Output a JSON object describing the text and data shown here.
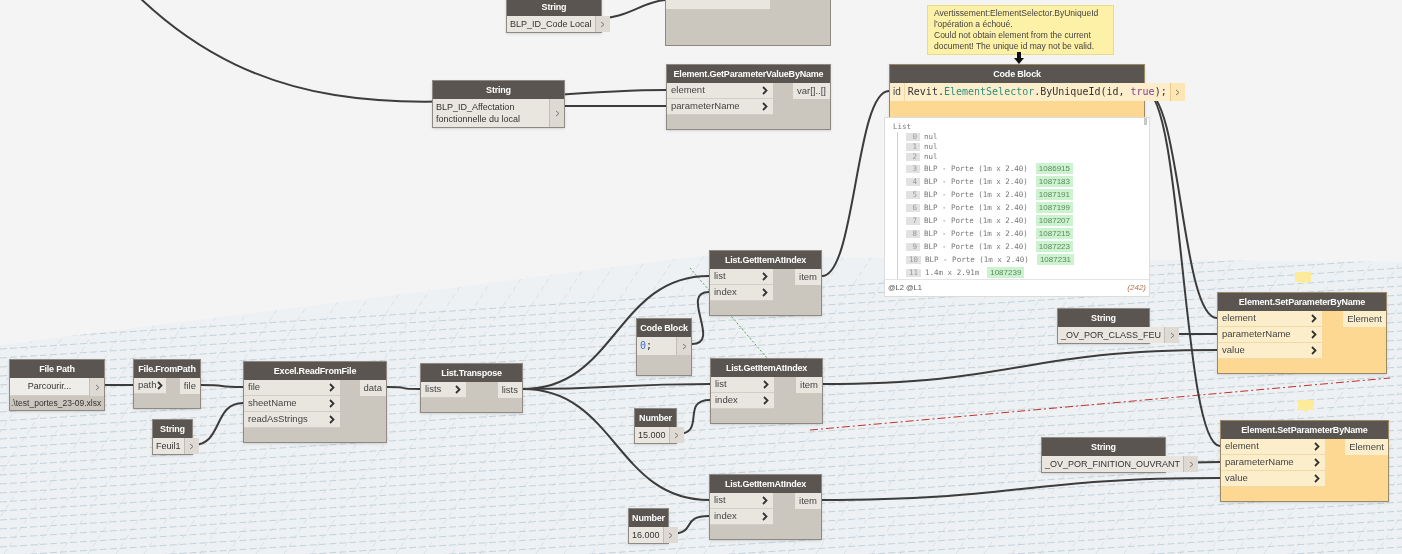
{
  "nodes": [
    {
      "kind": "input",
      "title": "String",
      "value": "BLP_ID_Code Local",
      "warning": false
    },
    {
      "kind": "input",
      "title": "String",
      "value": "BLP_ID_Affectation fonctionnelle du local",
      "warning": false
    },
    {
      "kind": "function",
      "title": "Element.GetParameterValueByName",
      "inputs": [
        "element",
        "parameterName"
      ],
      "outputs": [
        "var[]..[]"
      ],
      "warning": false
    },
    {
      "kind": "function",
      "title": "List.GetItemAtIndex",
      "inputs": [
        "list",
        "index"
      ],
      "outputs": [
        "item"
      ],
      "warning": false
    },
    {
      "kind": "code_block",
      "title": "Code Block",
      "input": "id",
      "code": [
        {
          "kind": "plain",
          "text": "Revit."
        },
        {
          "kind": "class",
          "text": "ElementSelector"
        },
        {
          "kind": "plain",
          "text": ".ByUniqueId(id, "
        },
        {
          "kind": "keyword",
          "text": "true"
        },
        {
          "kind": "plain",
          "text": ");"
        }
      ],
      "warning": true,
      "tooltip": [
        "Avertissement:ElementSelector.ByUniqueId",
        "l'opération a échoué.",
        "Could not obtain element from the current",
        "document!  The unique id may not be valid."
      ],
      "preview": {
        "root": "List",
        "items": [
          {
            "index": "0",
            "text": "nul"
          },
          {
            "index": "1",
            "text": "nul"
          },
          {
            "index": "2",
            "text": "nul"
          },
          {
            "index": "3",
            "text": "BLP - Porte (1m x 2.40)",
            "id": "1086915"
          },
          {
            "index": "4",
            "text": "BLP - Porte (1m x 2.40)",
            "id": "1087183"
          },
          {
            "index": "5",
            "text": "BLP - Porte (1m x 2.40)",
            "id": "1087191"
          },
          {
            "index": "6",
            "text": "BLP - Porte (1m x 2.40)",
            "id": "1087199"
          },
          {
            "index": "7",
            "text": "BLP - Porte (1m x 2.40)",
            "id": "1087207"
          },
          {
            "index": "8",
            "text": "BLP - Porte (1m x 2.40)",
            "id": "1087215"
          },
          {
            "index": "9",
            "text": "BLP - Porte (1m x 2.40)",
            "id": "1087223"
          },
          {
            "index": "10",
            "text": "BLP - Porte (1m x 2.40)",
            "id": "1087231"
          },
          {
            "index": "11",
            "text": "1.4m x 2.91m",
            "id": "1087239"
          }
        ],
        "levels": [
          "@L2",
          "@L1"
        ],
        "count": "(242)"
      }
    },
    {
      "kind": "code_block",
      "title": "Code Block",
      "code": [
        {
          "kind": "number",
          "text": "0"
        },
        {
          "kind": "plain",
          "text": ";"
        }
      ],
      "warning": false
    },
    {
      "kind": "function",
      "title": "List.GetItemAtIndex",
      "inputs": [
        "list",
        "index"
      ],
      "outputs": [
        "item"
      ],
      "warning": false
    },
    {
      "kind": "input",
      "title": "Number",
      "value": "15.000",
      "warning": false
    },
    {
      "kind": "function",
      "title": "List.GetItemAtIndex",
      "inputs": [
        "list",
        "index"
      ],
      "outputs": [
        "item"
      ],
      "warning": false
    },
    {
      "kind": "input",
      "title": "Number",
      "value": "16.000",
      "warning": false
    },
    {
      "kind": "file_path",
      "title": "File Path",
      "button": "Parcourir...",
      "path": ".\\test_portes_23-09.xlsx",
      "warning": false
    },
    {
      "kind": "function",
      "title": "File.FromPath",
      "inputs": [
        "path"
      ],
      "outputs": [
        "file"
      ],
      "warning": false
    },
    {
      "kind": "input",
      "title": "String",
      "value": "Feuil1",
      "warning": false
    },
    {
      "kind": "function",
      "title": "Excel.ReadFromFile",
      "inputs": [
        "file",
        "sheetName",
        "readAsStrings"
      ],
      "outputs": [
        "data"
      ],
      "warning": false
    },
    {
      "kind": "function",
      "title": "List.Transpose",
      "inputs": [
        "lists"
      ],
      "outputs": [
        "lists"
      ],
      "warning": false
    },
    {
      "kind": "input",
      "title": "String",
      "value": "_OV_POR_CLASS_FEU",
      "warning": false
    },
    {
      "kind": "function",
      "title": "Element.SetParameterByName",
      "inputs": [
        "element",
        "parameterName",
        "value"
      ],
      "outputs": [
        "Element"
      ],
      "warning": true
    },
    {
      "kind": "input",
      "title": "String",
      "value": "_OV_POR_FINITION_OUVRANT",
      "warning": false
    },
    {
      "kind": "function",
      "title": "Element.SetParameterByName",
      "inputs": [
        "element",
        "parameterName",
        "value"
      ],
      "outputs": [
        "Element"
      ],
      "warning": true
    }
  ]
}
